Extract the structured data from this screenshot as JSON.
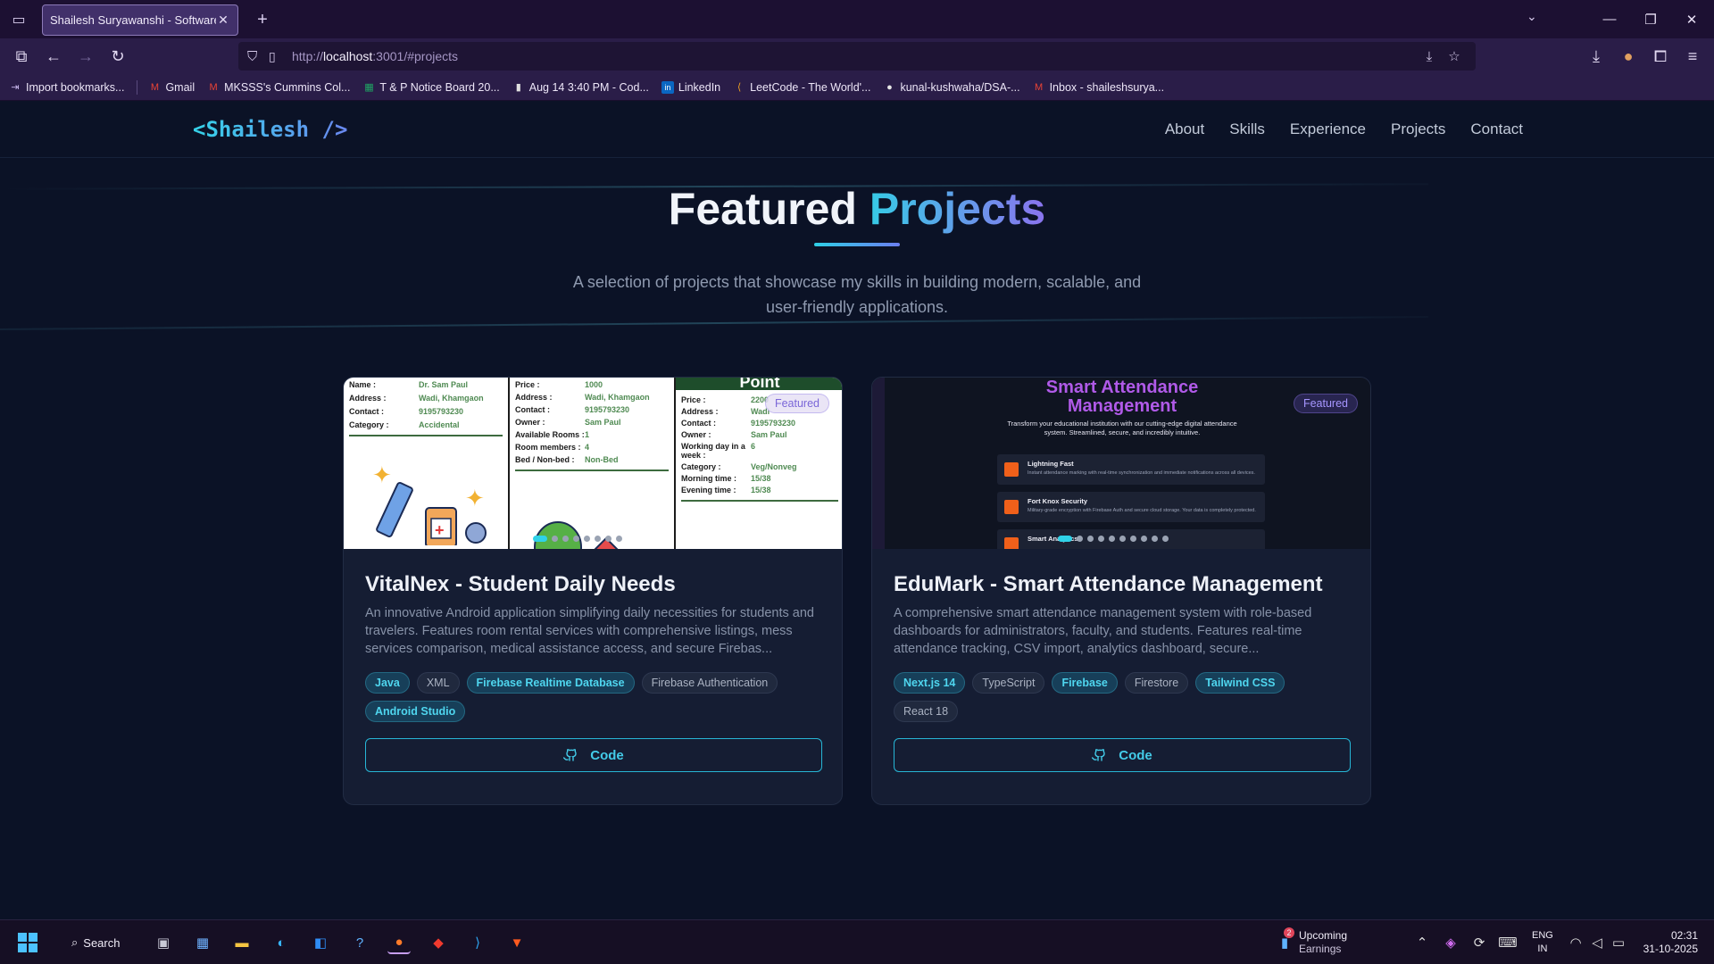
{
  "browser": {
    "tab_title": "Shailesh Suryawanshi - Software De",
    "url_prefix": "http://",
    "url_host": "localhost",
    "url_rest": ":3001/#projects"
  },
  "bookmarks": [
    {
      "label": "Import bookmarks...",
      "icon": "import-icon",
      "color": "#c9b8ee"
    },
    {
      "label": "Gmail",
      "icon": "gmail-icon",
      "color": "#ea4335"
    },
    {
      "label": "MKSSS's Cummins Col...",
      "icon": "gmail-icon",
      "color": "#ea4335"
    },
    {
      "label": "T & P Notice Board 20...",
      "icon": "sheets-icon",
      "color": "#1fa463"
    },
    {
      "label": "Aug 14 3:40 PM - Cod...",
      "icon": "codeforces-icon",
      "color": "#e0e0e0"
    },
    {
      "label": "LinkedIn",
      "icon": "linkedin-icon",
      "color": "#0a66c2"
    },
    {
      "label": "LeetCode - The World'...",
      "icon": "leetcode-icon",
      "color": "#f0a020"
    },
    {
      "label": "kunal-kushwaha/DSA-...",
      "icon": "github-icon",
      "color": "#e6e6e6"
    },
    {
      "label": "Inbox - shaileshsurya...",
      "icon": "gmail-icon",
      "color": "#ea4335"
    }
  ],
  "site": {
    "logo": "<Shailesh />",
    "nav": [
      "About",
      "Skills",
      "Experience",
      "Projects",
      "Contact"
    ]
  },
  "section": {
    "title_main": "Featured ",
    "title_accent": "Projects",
    "subtitle": "A selection of projects that showcase my skills in building modern, scalable, and user-friendly applications."
  },
  "projects": [
    {
      "badge": "Featured",
      "title": "VitalNex - Student Daily Needs",
      "description": "An innovative Android application simplifying daily necessities for students and travelers. Features room rental services with comprehensive listings, mess services comparison, medical assistance access, and secure Firebas...",
      "tags": [
        {
          "label": "Java",
          "highlight": true
        },
        {
          "label": "XML",
          "highlight": false
        },
        {
          "label": "Firebase Realtime Database",
          "highlight": true
        },
        {
          "label": "Firebase Authentication",
          "highlight": false
        },
        {
          "label": "Android Studio",
          "highlight": true
        }
      ],
      "button": "Code",
      "thumb": {
        "col1": [
          {
            "k": "Name :",
            "v": "Dr. Sam Paul"
          },
          {
            "k": "Address :",
            "v": "Wadi, Khamgaon"
          },
          {
            "k": "Contact :",
            "v": "9195793230"
          },
          {
            "k": "Category :",
            "v": "Accidental"
          }
        ],
        "col2": [
          {
            "k": "Price :",
            "v": "1000"
          },
          {
            "k": "Address :",
            "v": "Wadi, Khamgaon"
          },
          {
            "k": "Contact :",
            "v": "9195793230"
          },
          {
            "k": "Owner :",
            "v": "Sam Paul"
          },
          {
            "k": "Available Rooms :",
            "v": "1"
          },
          {
            "k": "Room members :",
            "v": "4"
          },
          {
            "k": "Bed / Non-bed :",
            "v": "Non-Bed"
          }
        ],
        "col3_header": "Point",
        "col3": [
          {
            "k": "Price :",
            "v": "2200"
          },
          {
            "k": "Address :",
            "v": "Wadi"
          },
          {
            "k": "Contact :",
            "v": "9195793230"
          },
          {
            "k": "Owner :",
            "v": "Sam Paul"
          },
          {
            "k": "Working day in a week :",
            "v": "6"
          },
          {
            "k": "Category :",
            "v": "Veg/Nonveg"
          },
          {
            "k": "Morning time :",
            "v": "15/38"
          },
          {
            "k": "Evening time :",
            "v": "15/38"
          }
        ]
      }
    },
    {
      "badge": "Featured",
      "title": "EduMark - Smart Attendance Management",
      "description": "A comprehensive smart attendance management system with role-based dashboards for administrators, faculty, and students. Features real-time attendance tracking, CSV import, analytics dashboard, secure...",
      "tags": [
        {
          "label": "Next.js 14",
          "highlight": true
        },
        {
          "label": "TypeScript",
          "highlight": false
        },
        {
          "label": "Firebase",
          "highlight": true
        },
        {
          "label": "Firestore",
          "highlight": false
        },
        {
          "label": "Tailwind CSS",
          "highlight": true
        },
        {
          "label": "React 18",
          "highlight": false
        }
      ],
      "button": "Code",
      "thumb": {
        "title": "Smart Attendance Management",
        "subtitle": "Transform your educational institution with our cutting-edge digital attendance system. Streamlined, secure, and incredibly intuitive.",
        "features": [
          {
            "title": "Lightning Fast",
            "text": "Instant attendance marking with real-time synchronization and immediate notifications across all devices."
          },
          {
            "title": "Fort Knox Security",
            "text": "Military-grade encryption with Firebase Auth and secure cloud storage. Your data is completely protected."
          },
          {
            "title": "Smart Analytics",
            "text": ""
          }
        ]
      }
    }
  ],
  "taskbar": {
    "search_label": "Search",
    "widget_badge": "2",
    "widget_line1": "Upcoming",
    "widget_line2": "Earnings",
    "lang1": "ENG",
    "lang2": "IN",
    "time": "02:31",
    "date": "31-10-2025"
  }
}
